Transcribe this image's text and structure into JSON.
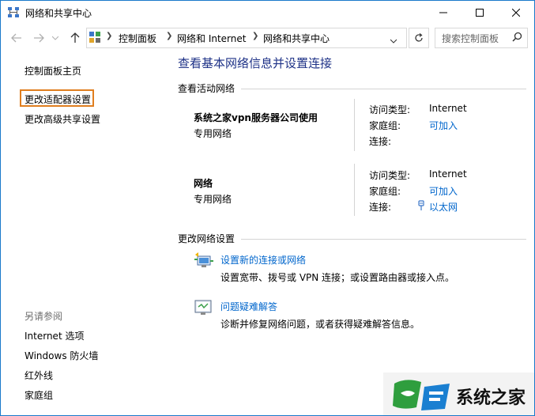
{
  "window": {
    "title": "网络和共享中心"
  },
  "address": {
    "crumbs": [
      "控制面板",
      "网络和 Internet",
      "网络和共享中心"
    ],
    "search_placeholder": "搜索控制面板"
  },
  "left": {
    "home": "控制面板主页",
    "adapter": "更改适配器设置",
    "advanced": "更改高级共享设置",
    "see_also_title": "另请参阅",
    "see_also": [
      "Internet 选项",
      "Windows 防火墙",
      "红外线",
      "家庭组"
    ]
  },
  "main": {
    "heading": "查看基本网络信息并设置连接",
    "active_title": "查看活动网络",
    "networks": [
      {
        "name": "系统之家vpn服务器公司使用",
        "type": "专用网络",
        "access_label": "访问类型:",
        "access": "Internet",
        "home_label": "家庭组:",
        "home": "可加入",
        "conn_label": "连接:",
        "conn": ""
      },
      {
        "name": "网络",
        "type": "专用网络",
        "access_label": "访问类型:",
        "access": "Internet",
        "home_label": "家庭组:",
        "home": "可加入",
        "conn_label": "连接:",
        "conn": "以太网"
      }
    ],
    "change_title": "更改网络设置",
    "tasks": [
      {
        "link": "设置新的连接或网络",
        "desc": "设置宽带、拨号或 VPN 连接；或设置路由器或接入点。",
        "icon": "new-connection-icon"
      },
      {
        "link": "问题疑难解答",
        "desc": "诊断并修复网络问题，或者获得疑难解答信息。",
        "icon": "troubleshoot-icon"
      }
    ]
  },
  "watermark": {
    "text": "系统之家"
  },
  "colors": {
    "accent": "#1979ca",
    "link": "#0066cc",
    "heading": "#1e3287",
    "highlight_box": "#e07e1f"
  }
}
